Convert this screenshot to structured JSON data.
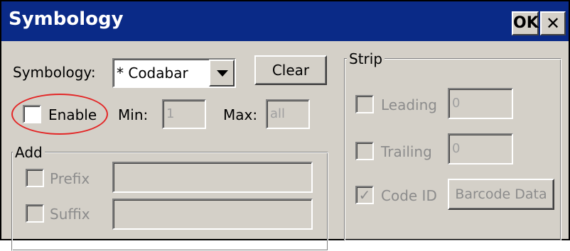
{
  "window": {
    "title": "Symbology",
    "ok_label": "OK",
    "close_glyph": "✕"
  },
  "symbology": {
    "label": "Symbology:",
    "selected": "* Codabar",
    "clear_label": "Clear"
  },
  "enable": {
    "label": "Enable",
    "checked": false,
    "min_label": "Min:",
    "min_value": "1",
    "max_label": "Max:",
    "max_value": "all"
  },
  "add": {
    "title": "Add",
    "prefix_label": "Prefix",
    "prefix_value": "",
    "suffix_label": "Suffix",
    "suffix_value": ""
  },
  "strip": {
    "title": "Strip",
    "leading_label": "Leading",
    "leading_value": "0",
    "trailing_label": "Trailing",
    "trailing_value": "0",
    "code_id_label": "Code ID",
    "code_id_checked": true,
    "code_id_glyph": "✓",
    "barcode_data_label": "Barcode Data"
  },
  "colors": {
    "titlebar": "#0a2a87",
    "dialog_bg": "#d4d0c8",
    "highlight_annotation": "#e32626"
  }
}
